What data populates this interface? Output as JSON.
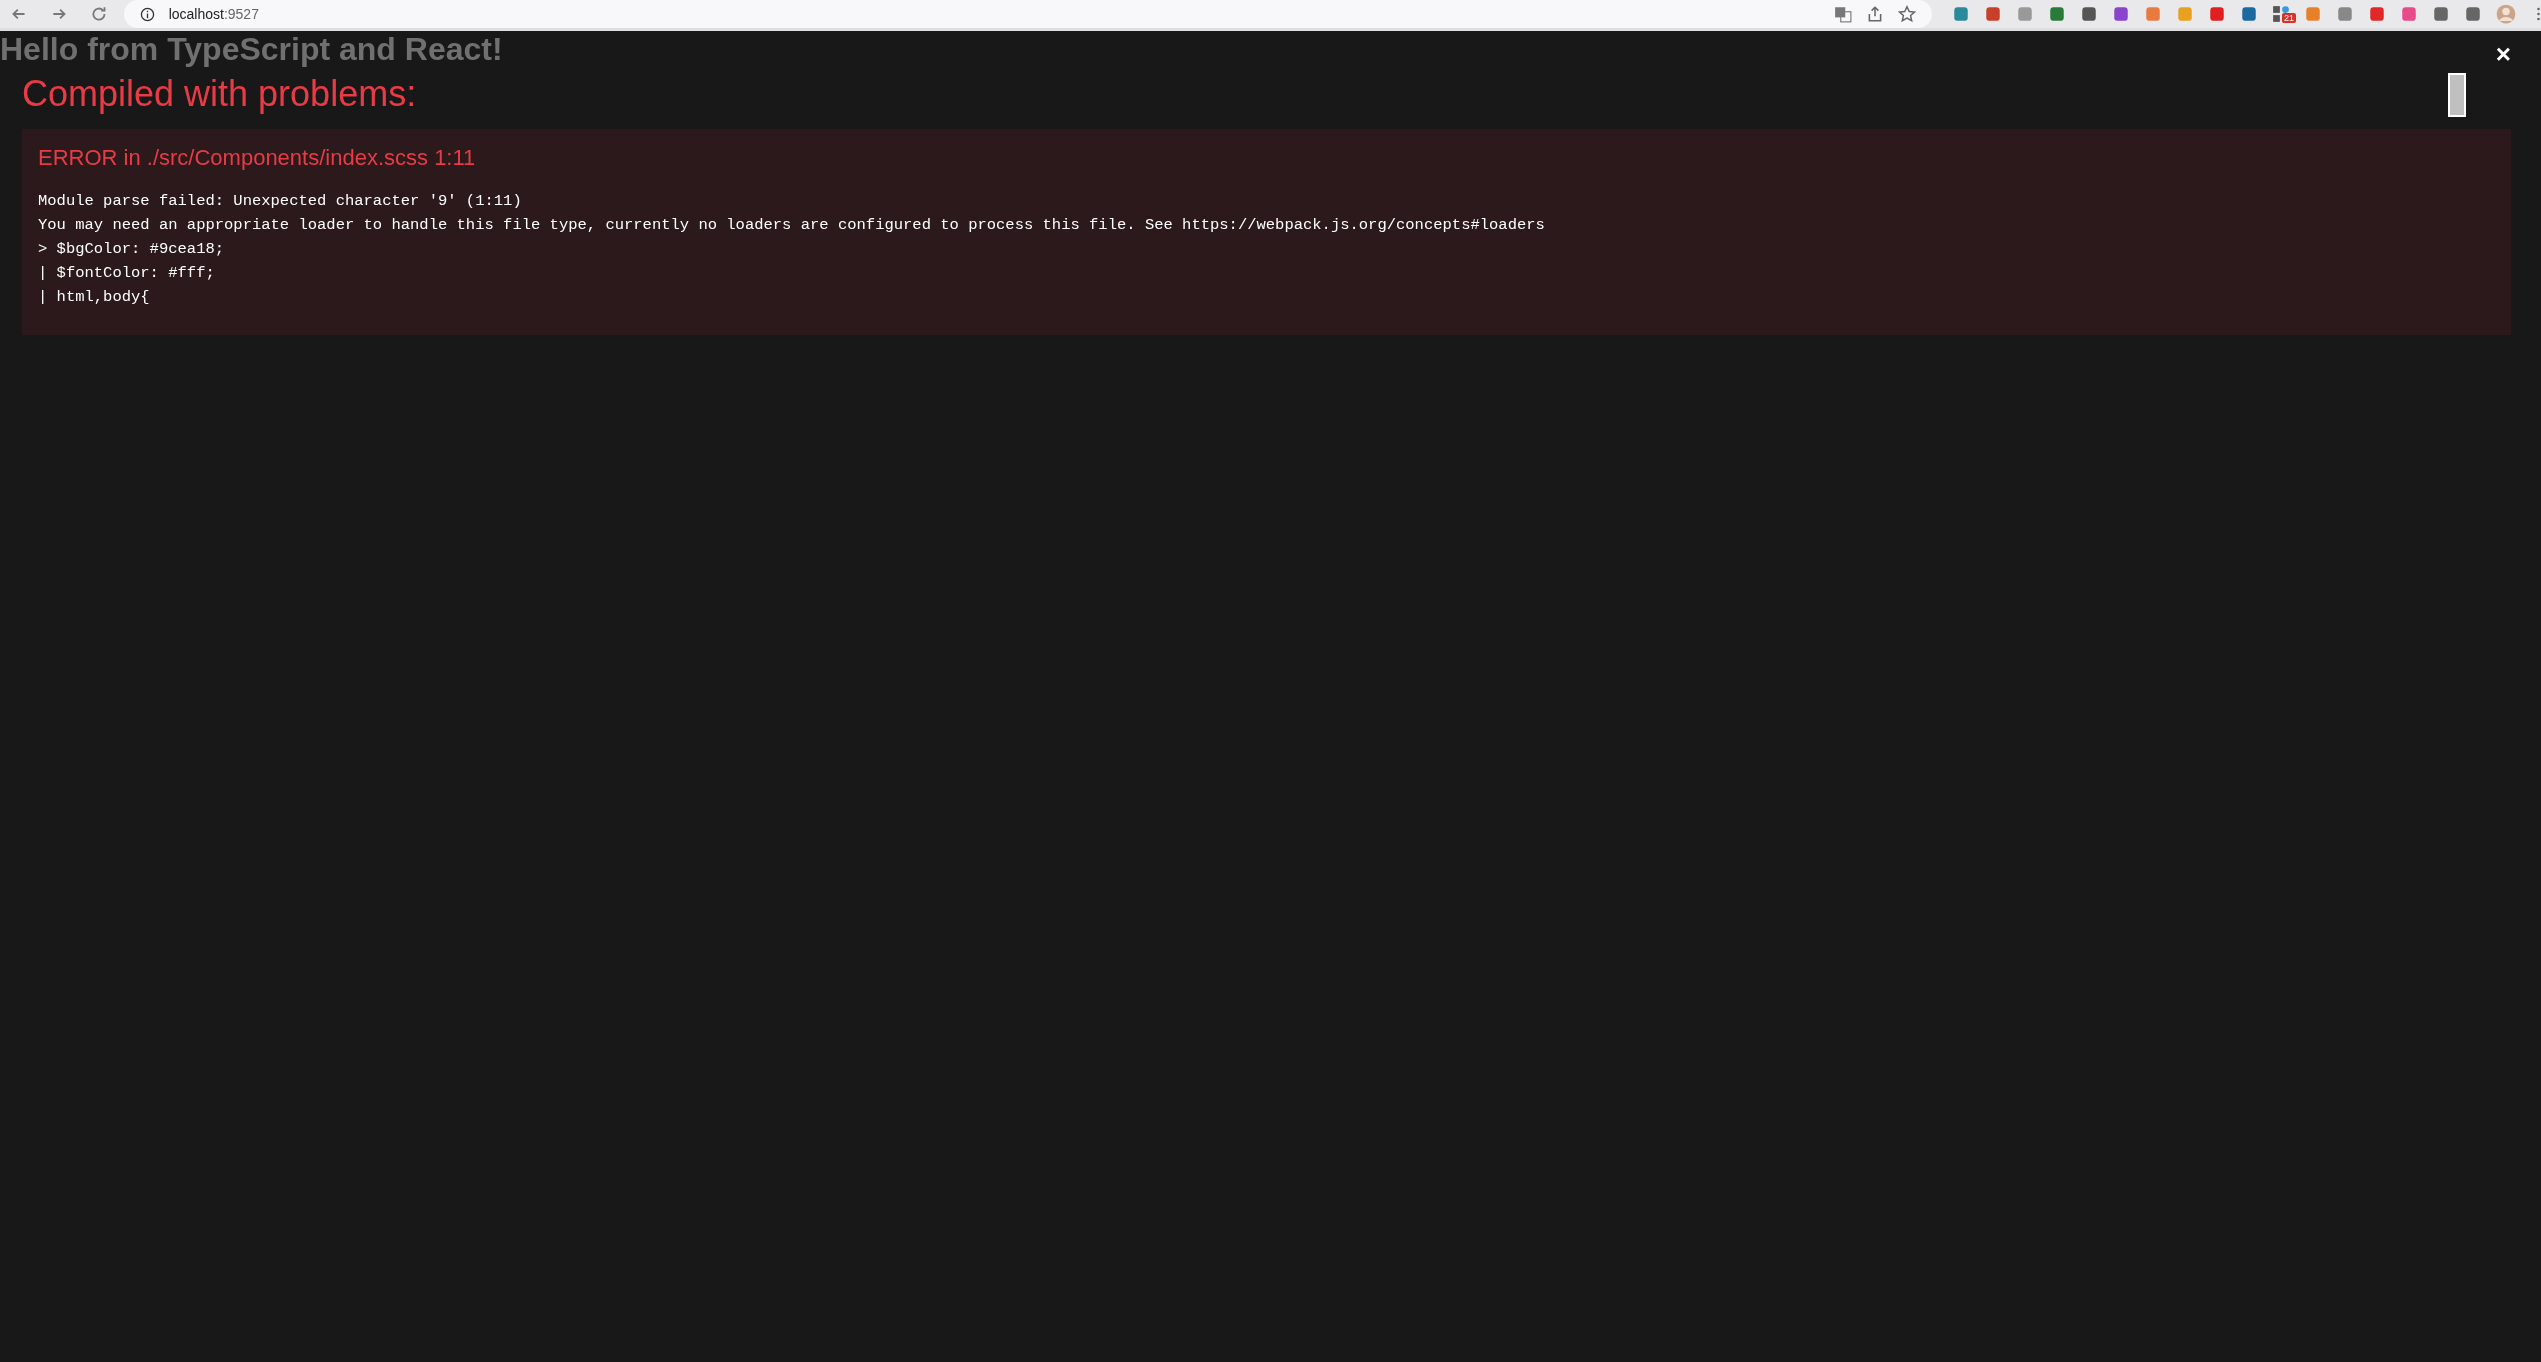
{
  "browser": {
    "address": {
      "host": "localhost",
      "port": ":9527"
    },
    "extension_badge": "21"
  },
  "page": {
    "heading": "Hello from TypeScript and React!"
  },
  "overlay": {
    "title": "Compiled with problems:",
    "close": "×",
    "errors": [
      {
        "title": "ERROR in ./src/Components/index.scss 1:11",
        "lines": [
          "Module parse failed: Unexpected character '9' (1:11)",
          "You may need an appropriate loader to handle this file type, currently no loaders are configured to process this file. See https://webpack.js.org/concepts#loaders",
          "> $bgColor: #9cea18;",
          "| $fontColor: #fff;",
          "| html,body{"
        ]
      }
    ]
  }
}
